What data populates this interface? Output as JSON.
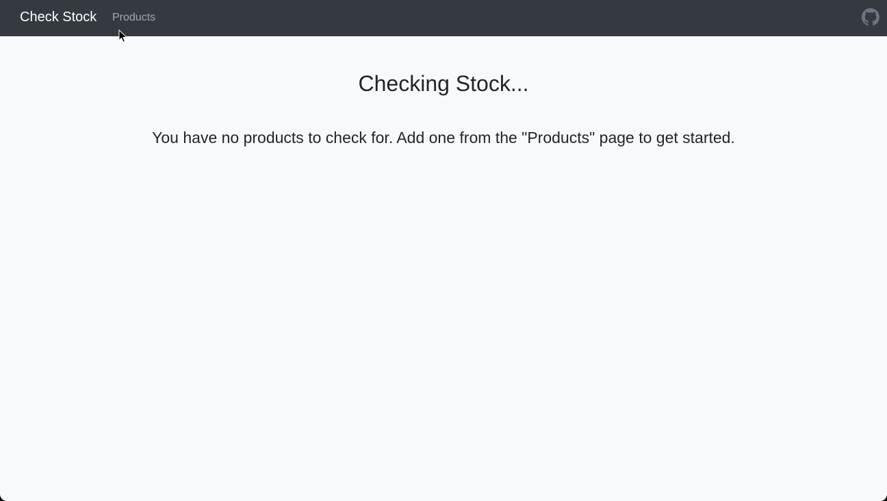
{
  "navbar": {
    "brand": "Check Stock",
    "links": [
      {
        "label": "Products"
      }
    ],
    "github_icon": "github-icon"
  },
  "main": {
    "title": "Checking Stock...",
    "message": "You have no products to check for. Add one from the \"Products\" page to get started."
  },
  "colors": {
    "navbar_bg": "#343a40",
    "page_bg": "#f8f9fa",
    "text": "#212529",
    "nav_link": "#8c8f92",
    "brand": "#ffffff"
  }
}
